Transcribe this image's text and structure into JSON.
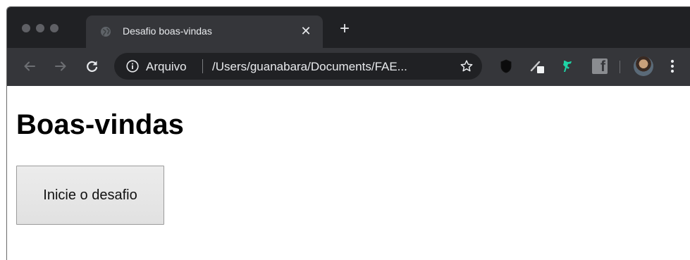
{
  "browser": {
    "tab": {
      "title": "Desafio boas-vindas",
      "close": "✕",
      "favicon": "globe-icon"
    },
    "new_tab": "+",
    "toolbar": {
      "back": "back-icon",
      "forward": "forward-icon",
      "reload": "reload-icon",
      "origin_label": "Arquivo",
      "url": "/Users/guanabara/Documents/FAE...",
      "bookmark": "star-icon",
      "extensions": [
        "shield-extension-icon",
        "pen-extension-icon",
        "green-extension-icon",
        "facebook-extension-icon"
      ],
      "facebook_glyph": "f",
      "profile": "avatar",
      "menu": "kebab-menu-icon"
    },
    "colors": {
      "tabstrip": "#202124",
      "toolbar": "#35363a",
      "omnibox": "#202124",
      "text": "#e8eaed",
      "accent_green": "#1fd3a6"
    }
  },
  "page": {
    "heading": "Boas-vindas",
    "button_label": "Inicie o desafio"
  }
}
